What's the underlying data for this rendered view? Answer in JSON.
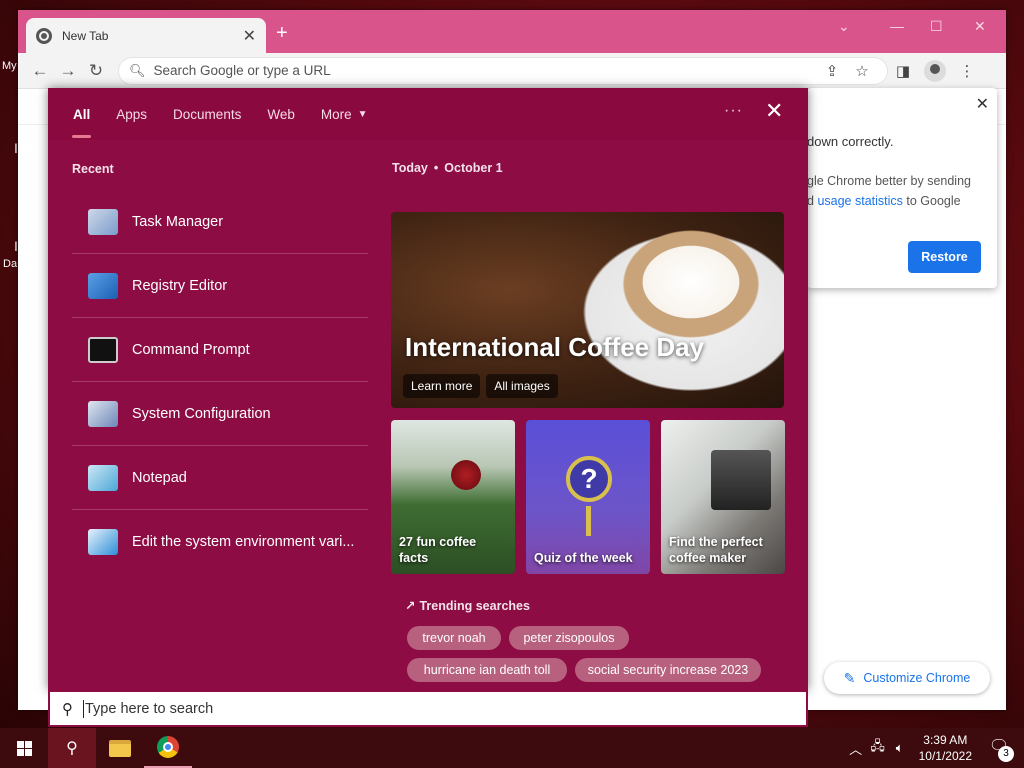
{
  "desktop": {
    "labels": [
      "My",
      "I",
      "I",
      "Da"
    ]
  },
  "browser": {
    "tab_title": "New Tab",
    "new_tab_glyph": "+",
    "omnibox_placeholder": "Search Google or type a URL",
    "restore_popup": {
      "line1": "down correctly.",
      "line2": "gle Chrome better by sending",
      "line3_prefix": "d ",
      "line3_link": "usage statistics",
      "line3_suffix": " to Google",
      "button": "Restore"
    },
    "customize_label": "Customize Chrome"
  },
  "search_panel": {
    "scopes": [
      "All",
      "Apps",
      "Documents",
      "Web",
      "More"
    ],
    "active_scope": "All",
    "recent_heading": "Recent",
    "recent_items": [
      {
        "label": "Task Manager",
        "icon": "task-manager-icon"
      },
      {
        "label": "Registry Editor",
        "icon": "registry-editor-icon"
      },
      {
        "label": "Command Prompt",
        "icon": "command-prompt-icon"
      },
      {
        "label": "System Configuration",
        "icon": "system-configuration-icon"
      },
      {
        "label": "Notepad",
        "icon": "notepad-icon"
      },
      {
        "label": "Edit the system environment vari...",
        "icon": "system-properties-icon"
      }
    ],
    "today_label": "Today",
    "today_date": "October 1",
    "hero": {
      "title": "International Coffee Day",
      "learn_more": "Learn more",
      "all_images": "All images"
    },
    "cards": [
      {
        "label": "27 fun coffee facts"
      },
      {
        "label": "Quiz of the week"
      },
      {
        "label": "Find the perfect coffee maker"
      }
    ],
    "trending_heading": "Trending searches",
    "trending": [
      "trevor noah",
      "peter zisopoulos",
      "hurricane ian death toll",
      "social security increase 2023"
    ]
  },
  "searchbox": {
    "placeholder": "Type here to search"
  },
  "taskbar": {
    "time": "3:39 AM",
    "date": "10/1/2022",
    "notification_count": "3"
  },
  "colors": {
    "panel_bg": "#8e0c44",
    "tabstrip": "#d9548a",
    "accent_blue": "#1a73e8"
  }
}
